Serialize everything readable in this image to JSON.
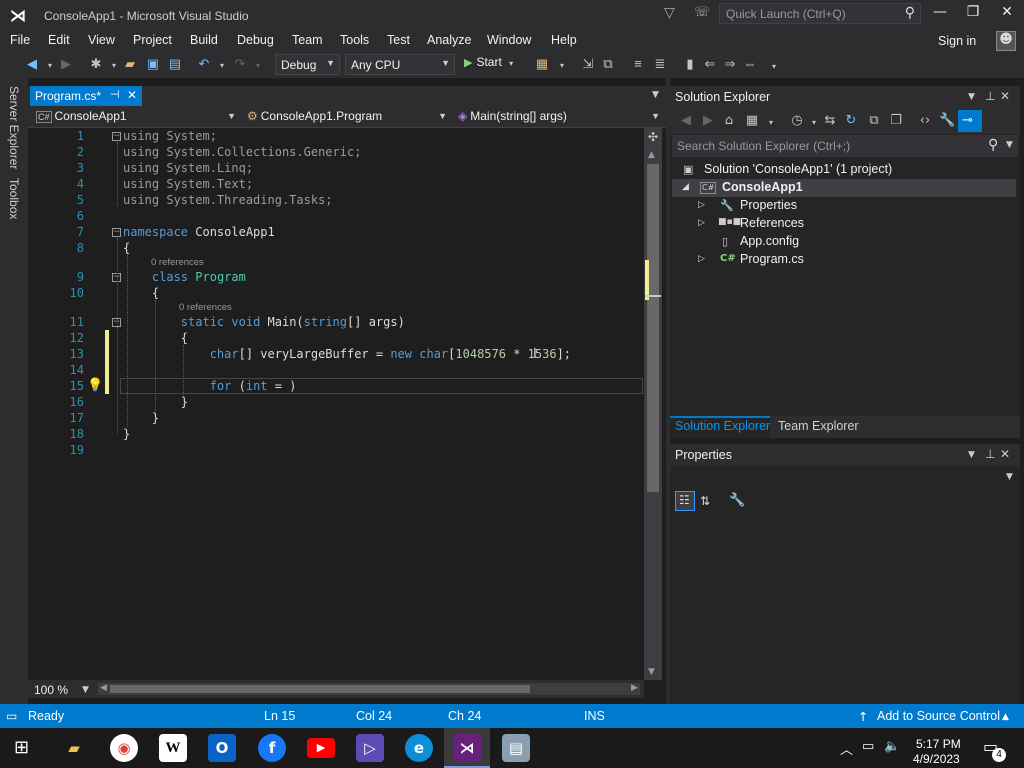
{
  "window": {
    "title": "ConsoleApp1 - Microsoft Visual Studio",
    "quick_launch_placeholder": "Quick Launch (Ctrl+Q)"
  },
  "menu": [
    "File",
    "Edit",
    "View",
    "Project",
    "Build",
    "Debug",
    "Team",
    "Tools",
    "Test",
    "Analyze",
    "Window",
    "Help"
  ],
  "account": {
    "signin": "Sign in"
  },
  "toolbar": {
    "config": "Debug",
    "platform": "Any CPU",
    "start": "Start"
  },
  "side_tabs": [
    "Server Explorer",
    "Toolbox"
  ],
  "editor": {
    "tab_label": "Program.cs*",
    "nav_project": "ConsoleApp1",
    "nav_class": "ConsoleApp1.Program",
    "nav_member": "Main(string[] args)",
    "line_numbers": [
      "1",
      "2",
      "3",
      "4",
      "5",
      "6",
      "7",
      "8",
      "9",
      "10",
      "11",
      "12",
      "13",
      "14",
      "15",
      "16",
      "17",
      "18",
      "19"
    ],
    "codelens": "0 references",
    "zoom": "100 %"
  },
  "solution_explorer": {
    "title": "Solution Explorer",
    "search_placeholder": "Search Solution Explorer (Ctrl+;)",
    "solution": "Solution 'ConsoleApp1' (1 project)",
    "project": "ConsoleApp1",
    "items": [
      "Properties",
      "References",
      "App.config",
      "Program.cs"
    ],
    "tabs": [
      "Solution Explorer",
      "Team Explorer"
    ]
  },
  "properties_panel": {
    "title": "Properties"
  },
  "status_bar": {
    "state": "Ready",
    "line": "Ln 15",
    "col": "Col 24",
    "ch": "Ch 24",
    "mode": "INS",
    "source_control": "Add to Source Control"
  },
  "taskbar": {
    "time": "5:17 PM",
    "date": "4/9/2023",
    "notification_count": "4"
  },
  "colors": {
    "accent": "#007acc",
    "keyword": "#569cd6",
    "type": "#4ec9b0",
    "number": "#b5cea8",
    "line_number": "#2b91af"
  }
}
